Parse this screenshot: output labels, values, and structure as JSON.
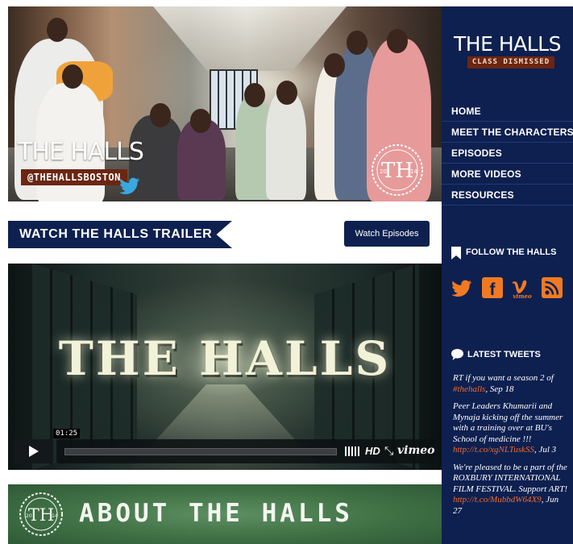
{
  "hero": {
    "title": "THE HALLS",
    "handle": "@THEHALLSBOSTON",
    "seal_year_left": "20",
    "seal_year_right": "14"
  },
  "trailer": {
    "heading": "WATCH THE HALLS TRAILER",
    "button_label": "Watch Episodes"
  },
  "video": {
    "title": "THE HALLS",
    "time_tooltip": "01:25",
    "hd_label": "HD",
    "fullscreen_symbol": "⤡",
    "brand": "vimeo"
  },
  "about": {
    "title": "ABOUT THE HALLS"
  },
  "sidebar": {
    "logo_title": "THE HALLS",
    "logo_subtitle": "CLASS DISMISSED",
    "nav": [
      {
        "label": "HOME"
      },
      {
        "label": "MEET THE CHARACTERS"
      },
      {
        "label": "EPISODES"
      },
      {
        "label": "MORE VIDEOS"
      },
      {
        "label": "RESOURCES"
      }
    ],
    "follow_label": "FOLLOW THE HALLS",
    "social_icons": [
      "twitter-icon",
      "facebook-icon",
      "vimeo-icon",
      "rss-icon"
    ],
    "tweets_label": "LATEST TWEETS",
    "tweets": [
      {
        "text": "RT if you want a season 2 of ",
        "link": "#thehalls",
        "date": ", Sep 18"
      },
      {
        "text": "Peer Leaders Khumarii and Mynaja kicking off the summer with a training over at BU's School of medicine !!! ",
        "link": "http://t.co/xgNLTuskSS",
        "date": ", Jul 3"
      },
      {
        "text": "We're pleased to be a part of the ROXBURY INTERNATIONAL FILM FESTIVAL. Support ART! ",
        "link": "http://t.co/MubbdW64X9",
        "date": ", Jun 27"
      }
    ]
  },
  "colors": {
    "navy": "#0e2050",
    "rust": "#6b2612",
    "accent_orange": "#f07a23",
    "link_orange": "#ef6a2a",
    "chalkboard_green": "#3f7145"
  }
}
